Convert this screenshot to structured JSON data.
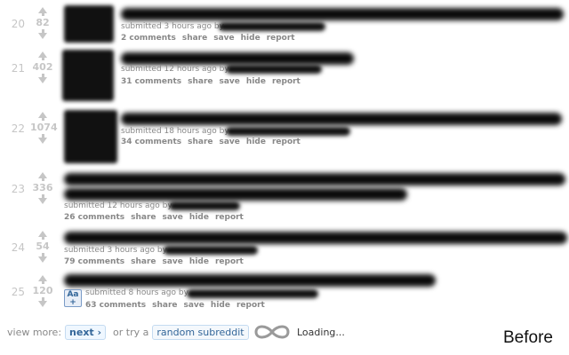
{
  "posts": [
    {
      "rank": "20",
      "score": "82",
      "tagline": "submitted 3 hours ago by",
      "buttons": {
        "comments": "2 comments",
        "share": "share",
        "save": "save",
        "hide": "hide",
        "report": "report"
      }
    },
    {
      "rank": "21",
      "score": "402",
      "tagline": "submitted 12 hours ago by",
      "buttons": {
        "comments": "31 comments",
        "share": "share",
        "save": "save",
        "hide": "hide",
        "report": "report"
      }
    },
    {
      "rank": "22",
      "score": "1074",
      "tagline": "submitted 18 hours ago by",
      "buttons": {
        "comments": "34 comments",
        "share": "share",
        "save": "save",
        "hide": "hide",
        "report": "report"
      }
    },
    {
      "rank": "23",
      "score": "336",
      "tagline": "submitted 12 hours ago by",
      "buttons": {
        "comments": "26 comments",
        "share": "share",
        "save": "save",
        "hide": "hide",
        "report": "report"
      }
    },
    {
      "rank": "24",
      "score": "54",
      "tagline": "submitted 3 hours ago by",
      "buttons": {
        "comments": "79 comments",
        "share": "share",
        "save": "save",
        "hide": "hide",
        "report": "report"
      }
    },
    {
      "rank": "25",
      "score": "120",
      "tagline": "submitted 8 hours ago by",
      "buttons": {
        "comments": "63 comments",
        "share": "share",
        "save": "save",
        "hide": "hide",
        "report": "report"
      }
    }
  ],
  "self_thumb": {
    "line1": "Aa",
    "line2": "+"
  },
  "footer": {
    "view_more": "view more:",
    "next": "next ›",
    "or_try": "or try a",
    "random": "random subreddit",
    "loading": "Loading..."
  },
  "watermark": "Before",
  "colors": {
    "accent": "#336699",
    "muted": "#888888",
    "arrow": "#c6c6c6"
  }
}
